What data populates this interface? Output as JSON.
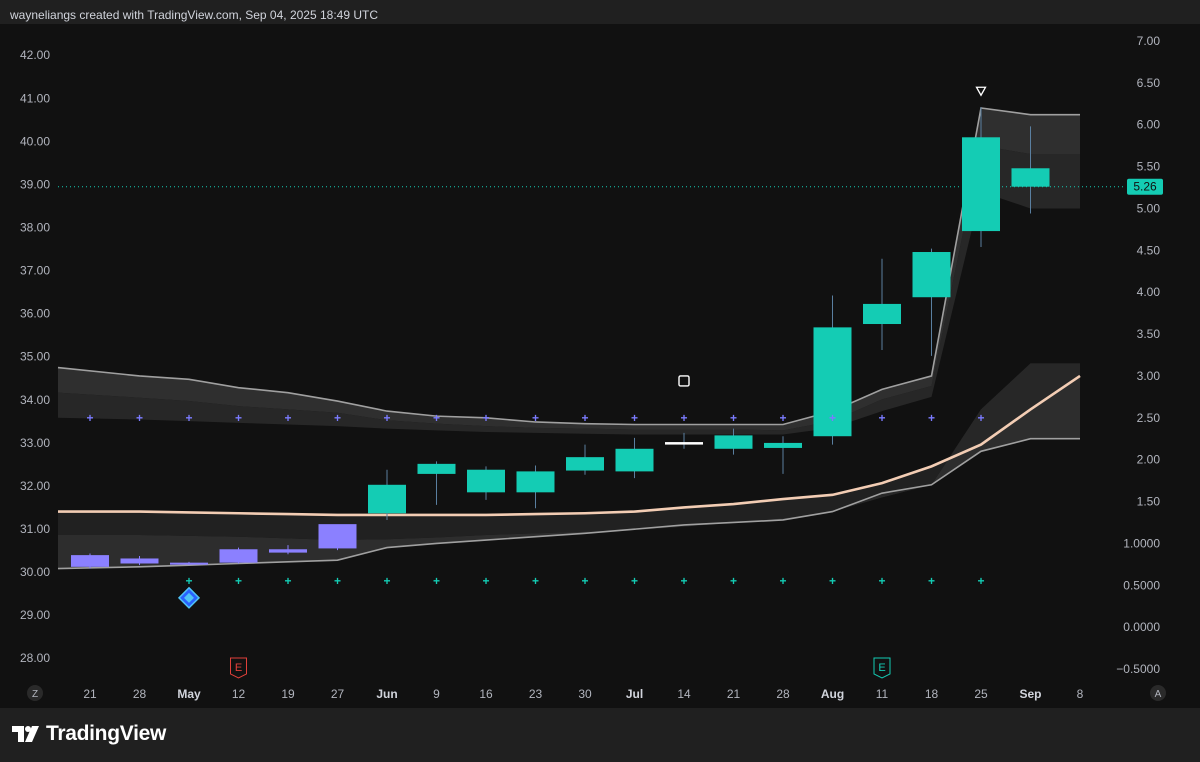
{
  "header": {
    "attribution": "wayneliangs created with TradingView.com, Sep 04, 2025 18:49 UTC"
  },
  "footer": {
    "brand": "TradingView"
  },
  "colors": {
    "background": "#202020",
    "plot_background": "#111111",
    "bull": "#14ccb4",
    "bear": "#8b80ff",
    "ma_line": "#f3cdb4",
    "band": "#9a9a9a",
    "last_price": "#14ccb4"
  },
  "chart_data": {
    "type": "candlestick",
    "timeframe": "weekly",
    "x_ticks": [
      {
        "label": "21",
        "major": false
      },
      {
        "label": "28",
        "major": false
      },
      {
        "label": "May",
        "major": true
      },
      {
        "label": "12",
        "major": false
      },
      {
        "label": "19",
        "major": false
      },
      {
        "label": "27",
        "major": false
      },
      {
        "label": "Jun",
        "major": true
      },
      {
        "label": "9",
        "major": false
      },
      {
        "label": "16",
        "major": false
      },
      {
        "label": "23",
        "major": false
      },
      {
        "label": "30",
        "major": false
      },
      {
        "label": "Jul",
        "major": true
      },
      {
        "label": "14",
        "major": false
      },
      {
        "label": "21",
        "major": false
      },
      {
        "label": "28",
        "major": false
      },
      {
        "label": "Aug",
        "major": true
      },
      {
        "label": "11",
        "major": false
      },
      {
        "label": "18",
        "major": false
      },
      {
        "label": "25",
        "major": false
      },
      {
        "label": "Sep",
        "major": true
      },
      {
        "label": "8",
        "major": false
      }
    ],
    "left_axis": {
      "ticks": [
        "42.00",
        "41.00",
        "40.00",
        "39.00",
        "38.00",
        "37.00",
        "36.00",
        "35.00",
        "34.00",
        "33.00",
        "32.00",
        "31.00",
        "30.00",
        "29.00",
        "28.00"
      ],
      "range": [
        27.75,
        42.33
      ]
    },
    "right_axis": {
      "ticks": [
        "7.00",
        "6.50",
        "6.00",
        "5.50",
        "5.00",
        "4.50",
        "4.00",
        "3.50",
        "3.00",
        "2.50",
        "2.00",
        "1.50",
        "1.0000",
        "0.5000",
        "0.0000",
        "−0.5000"
      ],
      "range": [
        -0.5,
        7.0
      ]
    },
    "last_price": {
      "value": 5.26,
      "label": "5.26"
    },
    "candles": [
      {
        "o": 0.72,
        "h": 0.88,
        "l": 0.7,
        "c": 0.86
      },
      {
        "o": 0.76,
        "h": 0.85,
        "l": 0.74,
        "c": 0.82
      },
      {
        "o": 0.75,
        "h": 0.78,
        "l": 0.74,
        "c": 0.77
      },
      {
        "o": 0.77,
        "h": 0.95,
        "l": 0.76,
        "c": 0.93
      },
      {
        "o": 0.89,
        "h": 0.98,
        "l": 0.87,
        "c": 0.93
      },
      {
        "o": 0.94,
        "h": 1.22,
        "l": 0.92,
        "c": 1.23
      },
      {
        "o": 1.36,
        "h": 1.88,
        "l": 1.28,
        "c": 1.7
      },
      {
        "o": 1.83,
        "h": 1.98,
        "l": 1.46,
        "c": 1.95
      },
      {
        "o": 1.61,
        "h": 1.92,
        "l": 1.52,
        "c": 1.88
      },
      {
        "o": 1.61,
        "h": 1.93,
        "l": 1.42,
        "c": 1.86
      },
      {
        "o": 1.87,
        "h": 2.18,
        "l": 1.82,
        "c": 2.03
      },
      {
        "o": 1.86,
        "h": 2.26,
        "l": 1.78,
        "c": 2.13
      },
      {
        "o": 2.18,
        "h": 2.32,
        "l": 2.13,
        "c": 2.21
      },
      {
        "o": 2.13,
        "h": 2.37,
        "l": 2.06,
        "c": 2.29
      },
      {
        "o": 2.14,
        "h": 2.28,
        "l": 1.83,
        "c": 2.2
      },
      {
        "o": 2.28,
        "h": 3.96,
        "l": 2.18,
        "c": 3.58
      },
      {
        "o": 3.62,
        "h": 4.4,
        "l": 3.31,
        "c": 3.86
      },
      {
        "o": 3.94,
        "h": 4.52,
        "l": 3.24,
        "c": 4.48
      },
      {
        "o": 4.73,
        "h": 6.21,
        "l": 4.54,
        "c": 5.85
      },
      {
        "o": 5.26,
        "h": 5.98,
        "l": 4.94,
        "c": 5.48
      }
    ],
    "moving_average": [
      1.38,
      1.38,
      1.37,
      1.36,
      1.35,
      1.34,
      1.34,
      1.34,
      1.34,
      1.35,
      1.36,
      1.38,
      1.43,
      1.47,
      1.53,
      1.58,
      1.72,
      1.92,
      2.18,
      2.6,
      3.0
    ],
    "band_upper_outer": [
      3.1,
      3.0,
      2.96,
      2.86,
      2.8,
      2.7,
      2.58,
      2.52,
      2.5,
      2.45,
      2.43,
      2.42,
      2.42,
      2.42,
      2.42,
      2.58,
      2.84,
      3.0,
      6.2,
      6.12,
      6.12
    ],
    "band_upper_inner": [
      2.8,
      2.74,
      2.7,
      2.64,
      2.6,
      2.56,
      2.47,
      2.43,
      2.4,
      2.38,
      2.37,
      2.36,
      2.36,
      2.36,
      2.35,
      2.46,
      2.72,
      2.88,
      5.75,
      5.65,
      5.65
    ],
    "band_mid_upper": [
      2.5,
      2.48,
      2.46,
      2.44,
      2.42,
      2.4,
      2.37,
      2.35,
      2.33,
      2.32,
      2.31,
      2.3,
      2.3,
      2.3,
      2.3,
      2.38,
      2.58,
      2.75,
      5.2,
      5.0,
      5.0
    ],
    "band_lower_inner": [
      1.1,
      1.1,
      1.09,
      1.08,
      1.06,
      1.04,
      1.05,
      1.07,
      1.1,
      1.12,
      1.14,
      1.16,
      1.2,
      1.25,
      1.3,
      1.38,
      1.55,
      1.7,
      2.6,
      3.15,
      3.15
    ],
    "band_lower_outer": [
      0.7,
      0.72,
      0.74,
      0.76,
      0.78,
      0.8,
      0.95,
      1.0,
      1.04,
      1.08,
      1.12,
      1.17,
      1.22,
      1.25,
      1.28,
      1.38,
      1.6,
      1.7,
      2.1,
      2.25,
      2.25
    ],
    "markers_top": {
      "y": 2.5,
      "from": 0,
      "to": 18,
      "color": "#7b7bff"
    },
    "markers_bottom": {
      "y": 0.55,
      "from": 2,
      "to": 18,
      "color": "#14ccb4"
    },
    "annotations": [
      {
        "type": "square",
        "index": 12,
        "value": 2.94
      },
      {
        "type": "triangle-down",
        "index": 18,
        "value": 6.4
      },
      {
        "type": "diamond",
        "index": 2,
        "value": 0.35
      }
    ],
    "earnings": [
      {
        "index": 3,
        "label": "E",
        "color": "#e0403a"
      },
      {
        "index": 16,
        "label": "E",
        "color": "#14ccb4"
      }
    ],
    "corner_labels": {
      "left": "Z",
      "right": "A"
    }
  }
}
